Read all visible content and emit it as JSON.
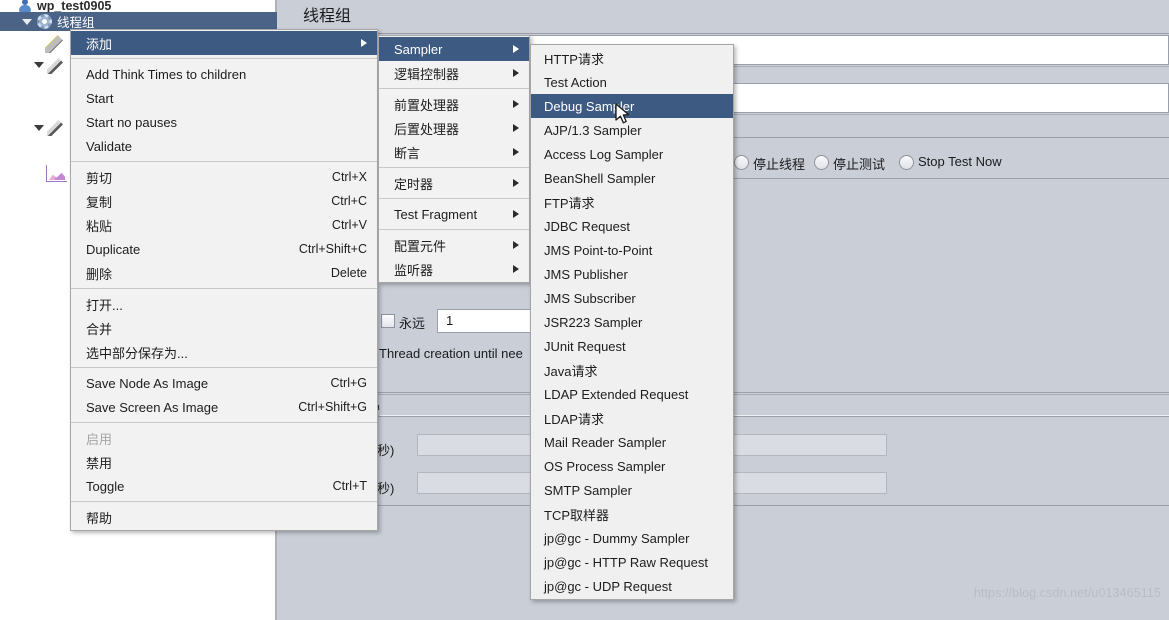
{
  "app": {
    "panel_title": "线程组",
    "watermark": "https://blog.csdn.net/u013465115"
  },
  "tree": {
    "root_label": "wp_test0905",
    "selected_label": "线程组",
    "items": [
      {
        "label": "wp_test0905",
        "icon": "user-icon"
      },
      {
        "label": "线程组",
        "icon": "gear-icon"
      }
    ]
  },
  "thread_group_panel": {
    "forever_checkbox_label": "永远",
    "loop_count_value": "1",
    "thread_creation_note": "Thread creation until nee",
    "scheduler_heading": "置",
    "duration_unit_label": "秒)",
    "startup_delay_unit_label": "秒)",
    "action_radios": [
      {
        "label": "停止线程",
        "checked": false
      },
      {
        "label": "停止测试",
        "checked": false
      },
      {
        "label": "Stop Test Now",
        "checked": false
      }
    ]
  },
  "context_menu": {
    "items": [
      {
        "label": "添加",
        "accel": "",
        "submenu": true,
        "selected": true,
        "disabled": false
      },
      {
        "type": "separator"
      },
      {
        "label": "Add Think Times to children",
        "accel": "",
        "submenu": false,
        "selected": false,
        "disabled": false
      },
      {
        "label": "Start",
        "accel": "",
        "submenu": false,
        "selected": false,
        "disabled": false
      },
      {
        "label": "Start no pauses",
        "accel": "",
        "submenu": false,
        "selected": false,
        "disabled": false
      },
      {
        "label": "Validate",
        "accel": "",
        "submenu": false,
        "selected": false,
        "disabled": false
      },
      {
        "type": "separator"
      },
      {
        "label": "剪切",
        "accel": "Ctrl+X",
        "submenu": false,
        "selected": false,
        "disabled": false
      },
      {
        "label": "复制",
        "accel": "Ctrl+C",
        "submenu": false,
        "selected": false,
        "disabled": false
      },
      {
        "label": "粘贴",
        "accel": "Ctrl+V",
        "submenu": false,
        "selected": false,
        "disabled": false
      },
      {
        "label": "Duplicate",
        "accel": "Ctrl+Shift+C",
        "submenu": false,
        "selected": false,
        "disabled": false
      },
      {
        "label": "删除",
        "accel": "Delete",
        "submenu": false,
        "selected": false,
        "disabled": false
      },
      {
        "type": "separator"
      },
      {
        "label": "打开...",
        "accel": "",
        "submenu": false,
        "selected": false,
        "disabled": false
      },
      {
        "label": "合并",
        "accel": "",
        "submenu": false,
        "selected": false,
        "disabled": false
      },
      {
        "label": "选中部分保存为...",
        "accel": "",
        "submenu": false,
        "selected": false,
        "disabled": false
      },
      {
        "type": "separator"
      },
      {
        "label": "Save Node As Image",
        "accel": "Ctrl+G",
        "submenu": false,
        "selected": false,
        "disabled": false
      },
      {
        "label": "Save Screen As Image",
        "accel": "Ctrl+Shift+G",
        "submenu": false,
        "selected": false,
        "disabled": false
      },
      {
        "type": "separator"
      },
      {
        "label": "启用",
        "accel": "",
        "submenu": false,
        "selected": false,
        "disabled": true
      },
      {
        "label": "禁用",
        "accel": "",
        "submenu": false,
        "selected": false,
        "disabled": false
      },
      {
        "label": "Toggle",
        "accel": "Ctrl+T",
        "submenu": false,
        "selected": false,
        "disabled": false
      },
      {
        "type": "separator"
      },
      {
        "label": "帮助",
        "accel": "",
        "submenu": false,
        "selected": false,
        "disabled": false
      }
    ]
  },
  "add_submenu": {
    "items": [
      {
        "label": "Sampler",
        "submenu": true,
        "selected": true
      },
      {
        "label": "逻辑控制器",
        "submenu": true,
        "selected": false
      },
      {
        "type": "separator"
      },
      {
        "label": "前置处理器",
        "submenu": true,
        "selected": false
      },
      {
        "label": "后置处理器",
        "submenu": true,
        "selected": false
      },
      {
        "label": "断言",
        "submenu": true,
        "selected": false
      },
      {
        "type": "separator"
      },
      {
        "label": "定时器",
        "submenu": true,
        "selected": false
      },
      {
        "type": "separator"
      },
      {
        "label": "Test Fragment",
        "submenu": true,
        "selected": false
      },
      {
        "type": "separator"
      },
      {
        "label": "配置元件",
        "submenu": true,
        "selected": false
      },
      {
        "label": "监听器",
        "submenu": true,
        "selected": false
      }
    ]
  },
  "sampler_submenu": {
    "items": [
      {
        "label": "HTTP请求",
        "selected": false
      },
      {
        "label": "Test Action",
        "selected": false
      },
      {
        "label": "Debug Sampler",
        "selected": true
      },
      {
        "label": "AJP/1.3 Sampler",
        "selected": false
      },
      {
        "label": "Access Log Sampler",
        "selected": false
      },
      {
        "label": "BeanShell Sampler",
        "selected": false
      },
      {
        "label": "FTP请求",
        "selected": false
      },
      {
        "label": "JDBC Request",
        "selected": false
      },
      {
        "label": "JMS Point-to-Point",
        "selected": false
      },
      {
        "label": "JMS Publisher",
        "selected": false
      },
      {
        "label": "JMS Subscriber",
        "selected": false
      },
      {
        "label": "JSR223 Sampler",
        "selected": false
      },
      {
        "label": "JUnit Request",
        "selected": false
      },
      {
        "label": "Java请求",
        "selected": false
      },
      {
        "label": "LDAP Extended Request",
        "selected": false
      },
      {
        "label": "LDAP请求",
        "selected": false
      },
      {
        "label": "Mail Reader Sampler",
        "selected": false
      },
      {
        "label": "OS Process Sampler",
        "selected": false
      },
      {
        "label": "SMTP Sampler",
        "selected": false
      },
      {
        "label": "TCP取样器",
        "selected": false
      },
      {
        "label": "jp@gc - Dummy Sampler",
        "selected": false
      },
      {
        "label": "jp@gc - HTTP Raw Request",
        "selected": false
      },
      {
        "label": "jp@gc - UDP Request",
        "selected": false
      }
    ]
  },
  "colors": {
    "menu_highlight": "#3d5a82",
    "tree_selection": "#4a6387",
    "menu_bg": "#f2f2f2",
    "app_bg": "#c9ced7"
  }
}
